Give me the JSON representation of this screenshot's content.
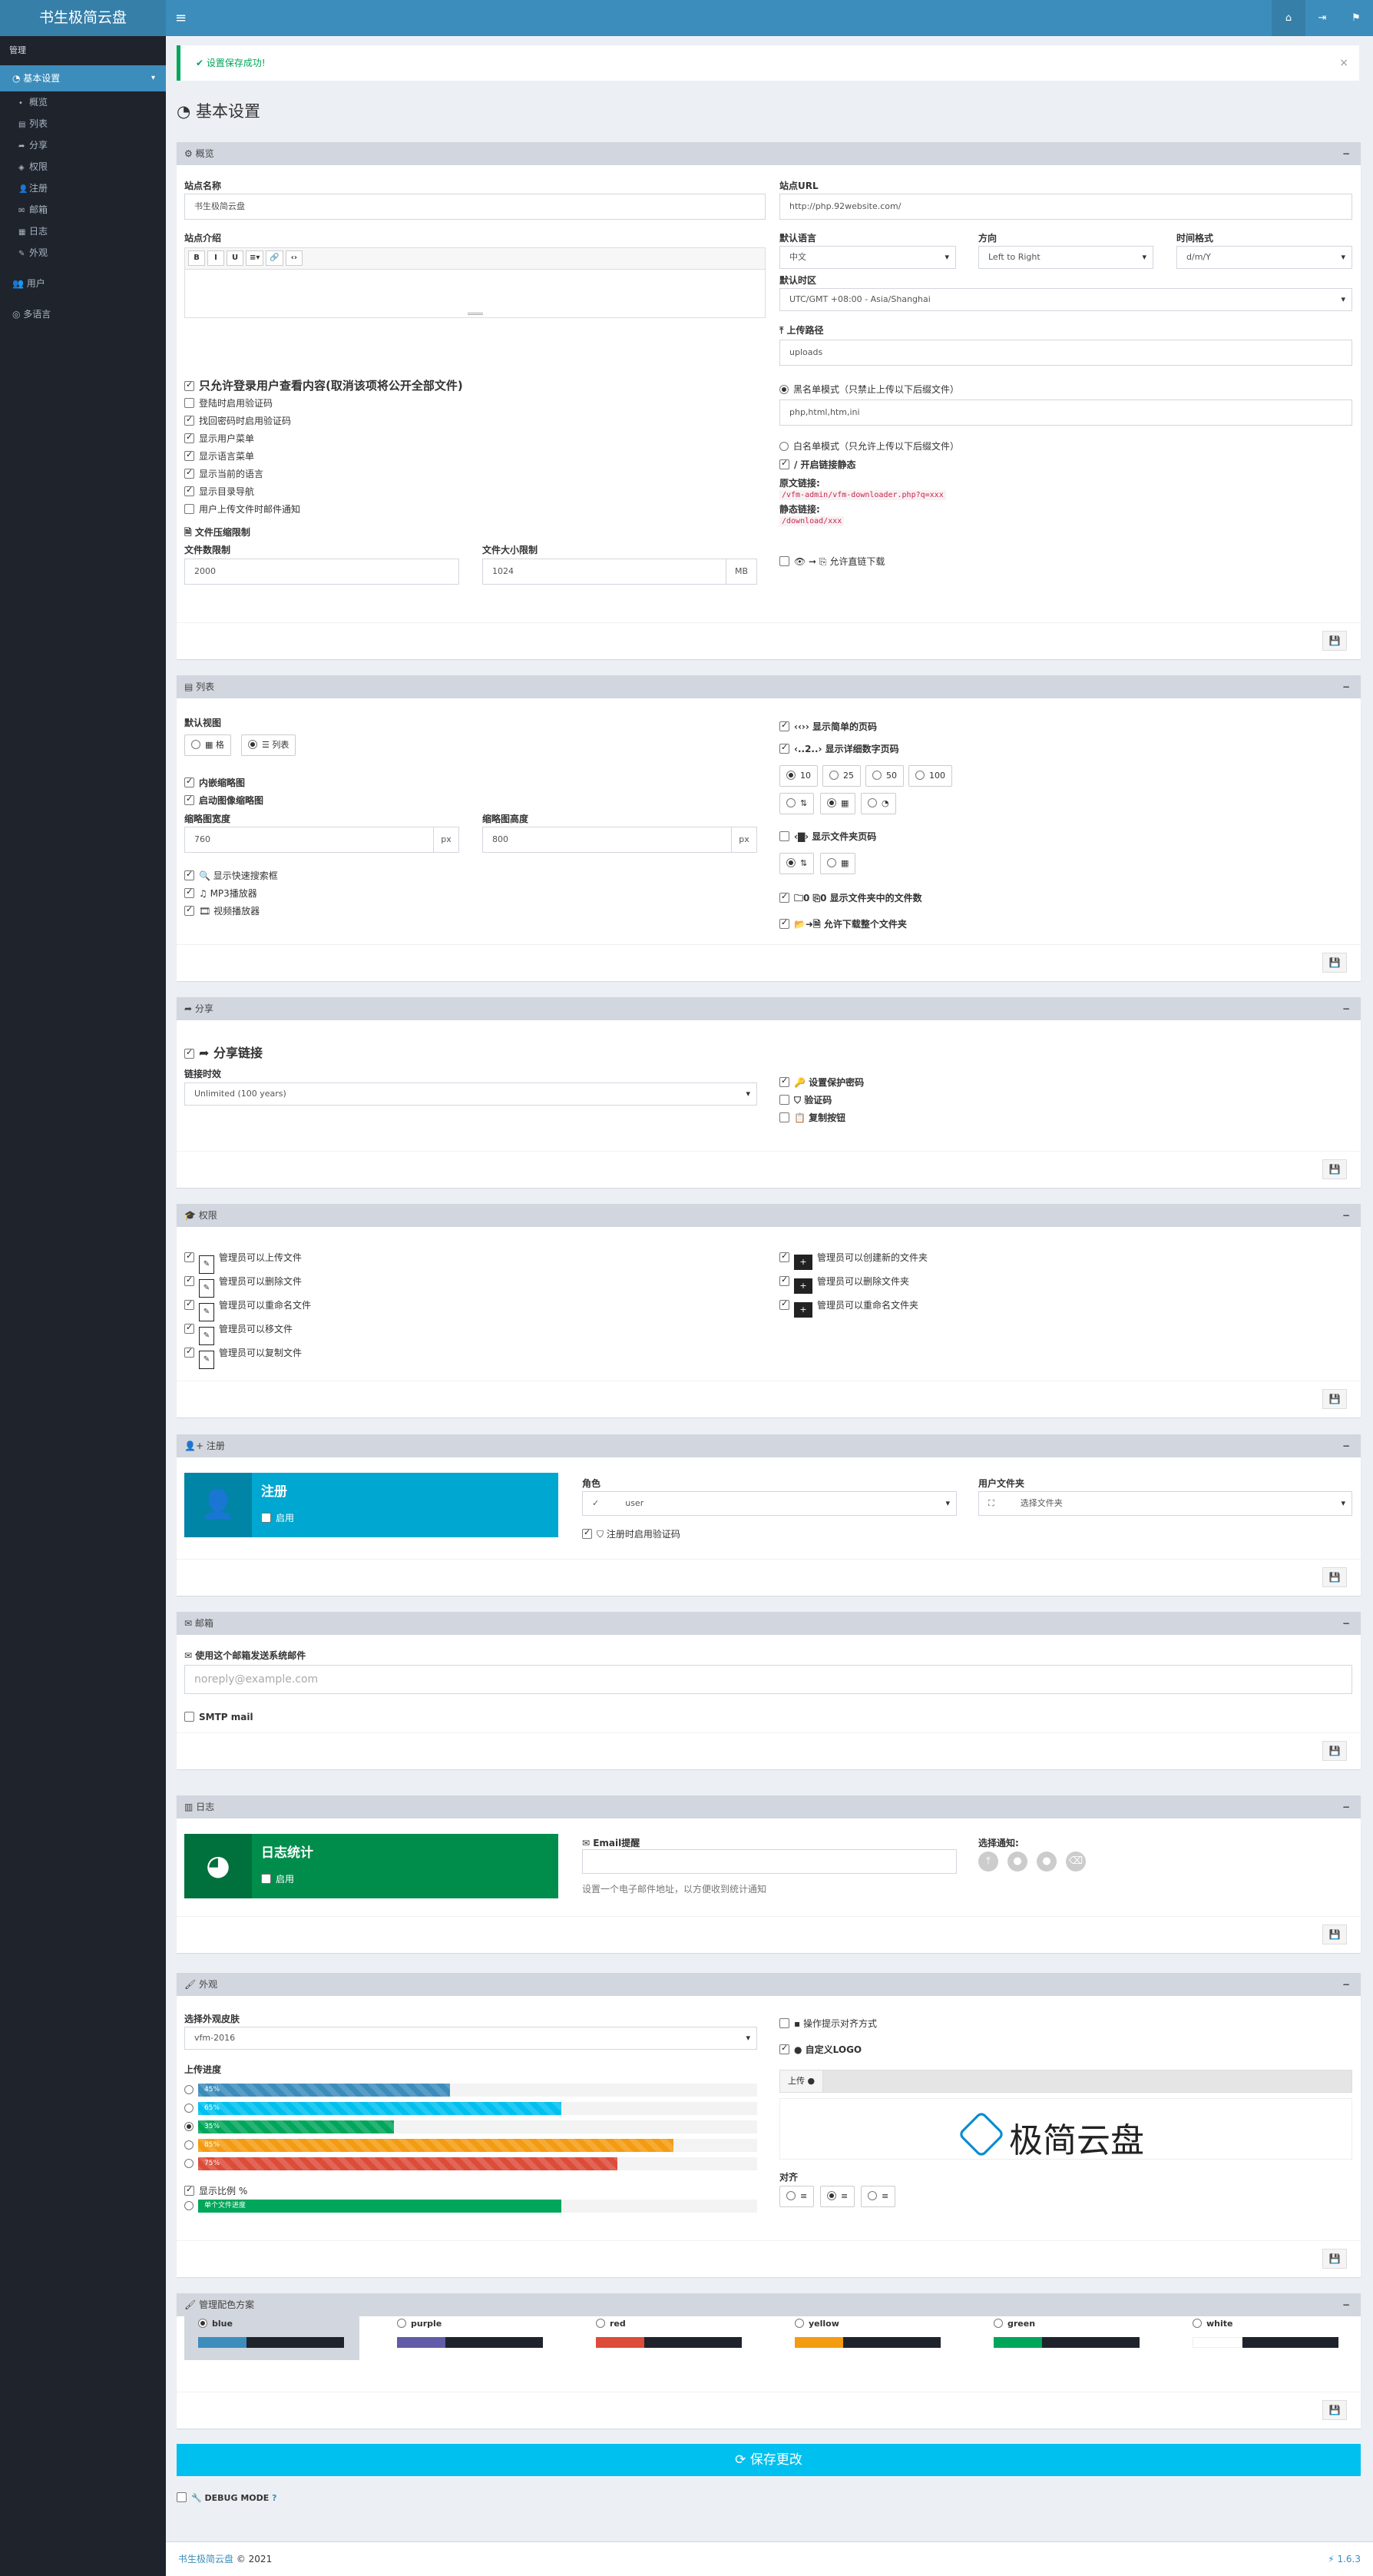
{
  "app": {
    "logo": "书生极简云盘",
    "menu_icon": "bars-icon",
    "top_icons": [
      "home-icon",
      "signout-icon",
      "flag-icon"
    ]
  },
  "sidebar": {
    "header": "管理",
    "active": "基本设置",
    "sub": [
      {
        "icon": "•",
        "label": "概览"
      },
      {
        "icon": "▤",
        "label": "列表"
      },
      {
        "icon": "➦",
        "label": "分享"
      },
      {
        "icon": "◈",
        "label": "权限"
      },
      {
        "icon": "👤",
        "label": "注册"
      },
      {
        "icon": "✉",
        "label": "邮箱"
      },
      {
        "icon": "▦",
        "label": "日志"
      },
      {
        "icon": "✎",
        "label": "外观"
      }
    ],
    "users": "用户",
    "lang": "多语言"
  },
  "alert": {
    "text": "✔ 设置保存成功!",
    "close": "×"
  },
  "page": {
    "title": "基本设置"
  },
  "overview": {
    "header": "概览",
    "site_name_label": "站点名称",
    "site_name": "书生极简云盘",
    "site_desc_label": "站点介绍",
    "editor_btns": [
      "B",
      "I",
      "U",
      "≡▾",
      "🔗",
      "‹›"
    ],
    "checks": [
      {
        "on": true,
        "label": "只允许登录用户查看内容(取消该项将公开全部文件)",
        "big": true
      },
      {
        "on": false,
        "label": "登陆时启用验证码"
      },
      {
        "on": true,
        "label": "找回密码时启用验证码"
      },
      {
        "on": true,
        "label": "显示用户菜单"
      },
      {
        "on": true,
        "label": "显示语言菜单"
      },
      {
        "on": true,
        "label": "显示当前的语言"
      },
      {
        "on": true,
        "label": "显示目录导航"
      },
      {
        "on": false,
        "label": "用户上传文件时邮件通知"
      }
    ],
    "compress_label": "文件压缩限制",
    "files_limit_label": "文件数限制",
    "files_limit": "2000",
    "size_limit_label": "文件大小限制",
    "size_limit": "1024",
    "size_unit": "MB",
    "site_url_label": "站点URL",
    "site_url": "http://php.92website.com/",
    "lang_label": "默认语言",
    "lang": "中文",
    "dir_label": "方向",
    "dir": "Left to Right",
    "time_label": "时间格式",
    "time": "d/m/Y",
    "tz_label": "默认时区",
    "tz": "UTC/GMT +08:00 - Asia/Shanghai",
    "upload_path_label": "上传路径",
    "upload_path": "uploads",
    "blacklist_label": "黑名单模式（只禁止上传以下后缀文件）",
    "blacklist": "php,html,htm,ini",
    "whitelist_label": "白名单模式（只允许上传以下后缀文件）",
    "static_label": "/ 开启链接静态",
    "orig_link_label": "原文链接:",
    "orig_link": "/vfm-admin/vfm-downloader.php?q=xxx",
    "static_link_label": "静态链接:",
    "static_link": "/download/xxx",
    "direct_label": "允许直链下载"
  },
  "list": {
    "header": "列表",
    "view_label": "默认视图",
    "grid": "格",
    "list": "列表",
    "inline_thumb": "内嵌缩略图",
    "auto_thumb": "启动图像缩略图",
    "thumb_w_label": "缩略图宽度",
    "thumb_w": "760",
    "thumb_h_label": "缩略图高度",
    "thumb_h": "800",
    "px": "px",
    "quick_index": "显示快速搜索框",
    "mp3": "MP3播放器",
    "video": "视频播放器",
    "simple_pager": "‹‹›› 显示简单的页码",
    "detail_pager": "‹..2..› 显示详细数字页码",
    "counts": [
      "10",
      "25",
      "50",
      "100"
    ],
    "folder_pager": "显示文件夹页码",
    "folder_count": "显示文件夹中的文件数",
    "folder_dl": "允许下载整个文件夹"
  },
  "share": {
    "header": "分享",
    "share_link": "分享链接",
    "lifetime_label": "链接时效",
    "lifetime": "Unlimited (100 years)",
    "protect": "设置保护密码",
    "captcha": "验证码",
    "copy": "复制按钮"
  },
  "perm": {
    "header": "权限",
    "left": [
      "管理员可以上传文件",
      "管理员可以删除文件",
      "管理员可以重命名文件",
      "管理员可以移文件",
      "管理员可以复制文件"
    ],
    "right": [
      "管理员可以创建新的文件夹",
      "管理员可以删除文件夹",
      "管理员可以重命名文件夹"
    ]
  },
  "reg": {
    "header": "注册",
    "tile_title": "注册",
    "tile_enable": "启用",
    "role_label": "角色",
    "role": "user",
    "folder_label": "用户文件夹",
    "folder": "选择文件夹",
    "captcha": "注册时启用验证码"
  },
  "mail": {
    "header": "邮箱",
    "use_label": "使用这个邮箱发送系统邮件",
    "placeholder": "noreply@example.com",
    "smtp": "SMTP mail"
  },
  "log": {
    "header": "日志",
    "tile_title": "日志统计",
    "tile_enable": "启用",
    "email_label": "Email提醒",
    "hint": "设置一个电子邮件地址，以方便收到统计通知",
    "notify_label": "选择通知:"
  },
  "look": {
    "header": "外观",
    "skin_label": "选择外观皮肤",
    "skin": "vfm-2016",
    "progress_label": "上传进度",
    "bars": [
      {
        "pct": "45%",
        "v": 45,
        "c": "#3c8dbc"
      },
      {
        "pct": "65%",
        "v": 65,
        "c": "#00c0ef"
      },
      {
        "pct": "35%",
        "v": 35,
        "c": "#00a65a"
      },
      {
        "pct": "85%",
        "v": 85,
        "c": "#f39c12"
      },
      {
        "pct": "75%",
        "v": 75,
        "c": "#dd4b39"
      }
    ],
    "show_pct": "显示比例 %",
    "single": "单个文件进度",
    "align_hint": "操作提示对齐方式",
    "custom_logo": "自定义LOGO",
    "upload_btn": "上传",
    "logo_text": "极简云盘",
    "align_label": "对齐"
  },
  "scheme": {
    "header": "管理配色方案",
    "items": [
      {
        "name": "blue",
        "c": "#3c8dbc"
      },
      {
        "name": "purple",
        "c": "#605ca8"
      },
      {
        "name": "red",
        "c": "#dd4b39"
      },
      {
        "name": "yellow",
        "c": "#f39c12"
      },
      {
        "name": "green",
        "c": "#00a65a"
      },
      {
        "name": "white",
        "c": "#ffffff"
      }
    ]
  },
  "save": "保存更改",
  "debug": "DEBUG MODE",
  "footer": {
    "brand": "书生极简云盘",
    "year": "© 2021",
    "ver": "1.6.3"
  }
}
